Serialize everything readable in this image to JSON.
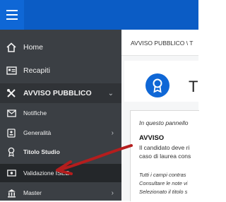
{
  "colors": {
    "topbar": "#0b5cc5",
    "sidebar": "#3b3f44",
    "accent": "#0f67d6",
    "arrow": "#b51d1d"
  },
  "sidebar": {
    "items": [
      {
        "label": "Home",
        "icon": "home-icon"
      },
      {
        "label": "Recapiti",
        "icon": "id-card-icon"
      },
      {
        "label": "AVVISO PUBBLICO",
        "icon": "tools-icon",
        "expanded": true
      },
      {
        "label": "Notifiche",
        "icon": "envelope-icon"
      },
      {
        "label": "Generalità",
        "icon": "address-card-icon"
      },
      {
        "label": "Titolo Studio",
        "icon": "award-icon"
      },
      {
        "label": "Validazione ISEE",
        "icon": "money-icon"
      },
      {
        "label": "Master",
        "icon": "bank-icon"
      }
    ]
  },
  "main": {
    "breadcrumb": "AVVISO PUBBLICO \\ T",
    "page_title": "Titol",
    "info": {
      "intro": "In questo pannello",
      "heading": "AVVISO",
      "line1": "Il candidato deve ri",
      "line2": "caso di laurea cons",
      "note1": "Tutti i campi contras",
      "note2": "Consultare le note vi",
      "note3": "Selezionato il titolo s"
    }
  }
}
